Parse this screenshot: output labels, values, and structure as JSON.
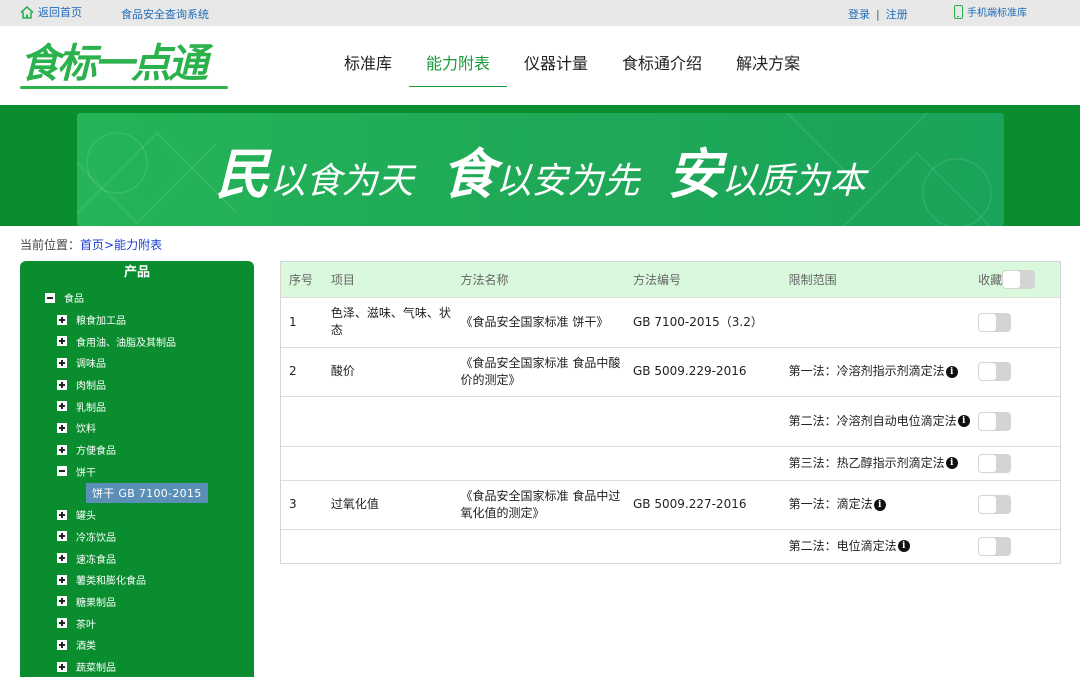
{
  "topbar": {
    "home": "返回首页",
    "system": "食品安全查询系统",
    "login": "登录",
    "separator": "|",
    "register": "注册",
    "mobile": "手机端标准库"
  },
  "header": {
    "logo_text": "食标一点通",
    "nav": [
      "标准库",
      "能力附表",
      "仪器计量",
      "食标通介绍",
      "解决方案"
    ],
    "active_nav": "能力附表"
  },
  "banner": {
    "seg1_big": "民",
    "seg1_small": "以食为天",
    "seg2_big": "食",
    "seg2_small": "以安为先",
    "seg3_big": "安",
    "seg3_small": "以质为本"
  },
  "breadcrumb": {
    "prefix": "当前位置：",
    "home": "首页",
    "sep": ">",
    "current": "能力附表"
  },
  "sidebar": {
    "title": "产品",
    "root": "食品",
    "children": [
      {
        "label": "粮食加工品",
        "expanded": false
      },
      {
        "label": "食用油、油脂及其制品",
        "expanded": false
      },
      {
        "label": "调味品",
        "expanded": false
      },
      {
        "label": "肉制品",
        "expanded": false
      },
      {
        "label": "乳制品",
        "expanded": false
      },
      {
        "label": "饮料",
        "expanded": false
      },
      {
        "label": "方便食品",
        "expanded": false
      },
      {
        "label": "饼干",
        "expanded": true
      },
      {
        "label": "饼干 GB 7100-2015",
        "leaf": true
      },
      {
        "label": "罐头",
        "expanded": false
      },
      {
        "label": "冷冻饮品",
        "expanded": false
      },
      {
        "label": "速冻食品",
        "expanded": false
      },
      {
        "label": "薯类和膨化食品",
        "expanded": false
      },
      {
        "label": "糖果制品",
        "expanded": false
      },
      {
        "label": "茶叶",
        "expanded": false
      },
      {
        "label": "酒类",
        "expanded": false
      },
      {
        "label": "蔬菜制品",
        "expanded": false
      }
    ]
  },
  "table": {
    "headers": [
      "序号",
      "项目",
      "方法名称",
      "方法编号",
      "限制范围",
      "收藏"
    ],
    "rows": [
      {
        "no": "1",
        "item": "色泽、滋味、气味、状态",
        "method": "《食品安全国家标准 饼干》",
        "code": "GB 7100-2015（3.2）",
        "scope": "",
        "info": false
      },
      {
        "no": "2",
        "item": "酸价",
        "method": "《食品安全国家标准 食品中酸价的测定》",
        "code": "GB 5009.229-2016",
        "scope": "第一法：冷溶剂指示剂滴定法",
        "info": true
      },
      {
        "no": "",
        "item": "",
        "method": "",
        "code": "",
        "scope": "第二法：冷溶剂自动电位滴定法",
        "info": true
      },
      {
        "no": "",
        "item": "",
        "method": "",
        "code": "",
        "scope": "第三法：热乙醇指示剂滴定法",
        "info": true
      },
      {
        "no": "3",
        "item": "过氧化值",
        "method": "《食品安全国家标准 食品中过氧化值的测定》",
        "code": "GB 5009.227-2016",
        "scope": "第一法：滴定法",
        "info": true
      },
      {
        "no": "",
        "item": "",
        "method": "",
        "code": "",
        "scope": "第二法：电位滴定法",
        "info": true
      }
    ],
    "info_glyph": "i"
  },
  "colors": {
    "brand_green": "#2bb24c",
    "banner_green": "#0a8d2e",
    "header_row": "#d9f8dc",
    "link_blue": "#1f6bb8"
  }
}
